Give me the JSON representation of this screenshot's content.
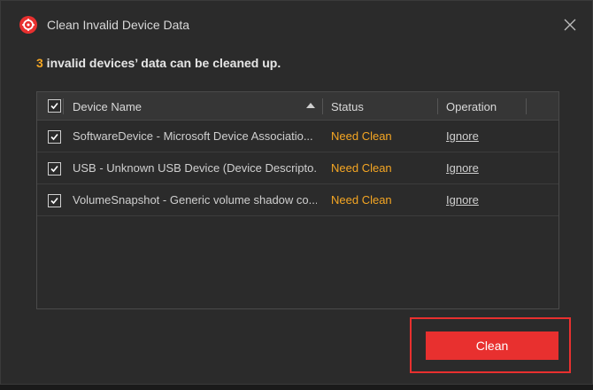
{
  "window": {
    "title": "Clean Invalid Device Data",
    "logo_icon": "brand-logo-icon",
    "close_icon": "close-icon"
  },
  "summary": {
    "count": "3",
    "text": " invalid devices’ data can be cleaned up."
  },
  "table": {
    "columns": [
      "Device Name",
      "Status",
      "Operation"
    ],
    "sort": {
      "column": "Device Name",
      "direction": "ascending"
    },
    "select_all_checked": true,
    "rows": [
      {
        "name": "SoftwareDevice - Microsoft Device Associatio...",
        "status": "Need Clean",
        "operation": "Ignore",
        "checked": true
      },
      {
        "name": "USB - Unknown USB Device (Device Descripto...",
        "status": "Need Clean",
        "operation": "Ignore",
        "checked": true
      },
      {
        "name": "VolumeSnapshot - Generic volume shadow co...",
        "status": "Need Clean",
        "operation": "Ignore",
        "checked": true
      }
    ]
  },
  "actions": {
    "clean_label": "Clean"
  },
  "colors": {
    "accent": "#e8302f",
    "status": "#f5a623",
    "background": "#2b2b2b"
  }
}
